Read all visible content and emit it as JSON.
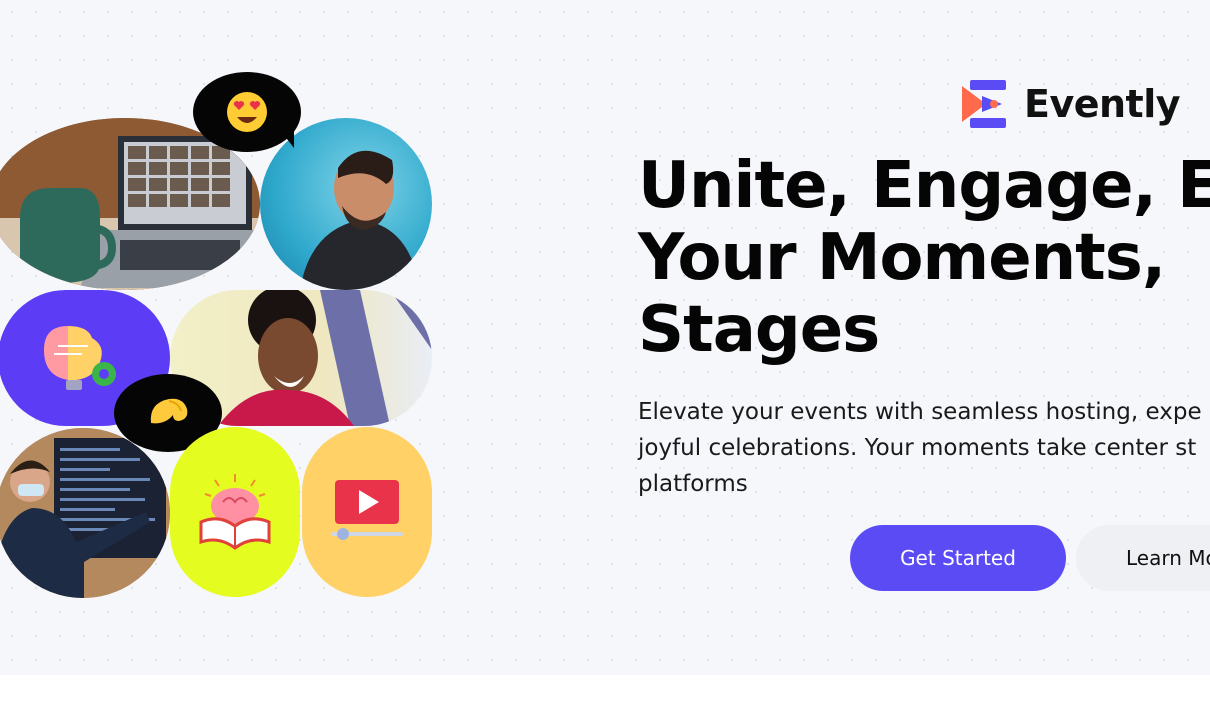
{
  "brand": {
    "name": "Evently",
    "accent": "#5b4bf5",
    "logo_orange": "#ff6a4d"
  },
  "hero": {
    "headline_lines": [
      "Unite, Engage, E",
      "Your Moments,",
      "Stages"
    ],
    "subtitle_lines": [
      "Elevate your events with seamless hosting, expe",
      "joyful celebrations. Your moments take center st",
      "platforms"
    ],
    "primary_cta": "Get Started",
    "secondary_cta": "Learn Mo"
  },
  "collage": {
    "reactions": [
      "heart-eyes-emoji",
      "pinched-fingers-emoji"
    ],
    "icons": [
      "brain-lightbulb-gear-icon",
      "brain-book-icon",
      "video-play-icon"
    ],
    "photos": [
      "laptop-video-call-photo",
      "laughing-man-photo",
      "smiling-woman-photo",
      "presenter-classroom-photo"
    ]
  }
}
